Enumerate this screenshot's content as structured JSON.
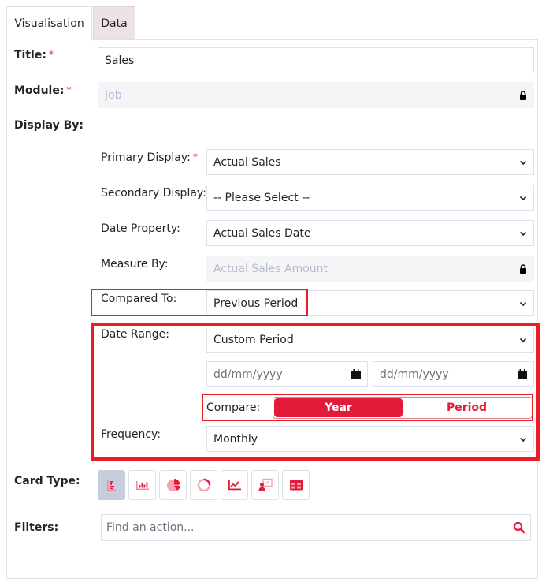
{
  "tabs": [
    {
      "label": "Visualisation",
      "active": true
    },
    {
      "label": "Data",
      "active": false
    }
  ],
  "form": {
    "title": {
      "label": "Title:",
      "required_mark": "*",
      "value": "Sales"
    },
    "module": {
      "label": "Module:",
      "required_mark": "*",
      "value": "Job",
      "locked": true
    },
    "display_by": {
      "label": "Display By:"
    },
    "primary_display": {
      "label": "Primary Display:",
      "required_mark": "*",
      "value": "Actual Sales"
    },
    "secondary_display": {
      "label": "Secondary Display:",
      "value": "-- Please Select --"
    },
    "date_property": {
      "label": "Date Property:",
      "value": "Actual Sales Date"
    },
    "measure_by": {
      "label": "Measure By:",
      "value": "Actual Sales Amount",
      "locked": true
    },
    "compared_to": {
      "label": "Compared To:",
      "value": "Previous Period"
    },
    "date_range": {
      "label": "Date Range:",
      "value": "Custom Period",
      "start_placeholder": "dd/mm/yyyy",
      "end_placeholder": "dd/mm/yyyy"
    },
    "compare": {
      "label": "Compare:",
      "options": [
        "Year",
        "Period"
      ],
      "selected": "Year"
    },
    "frequency": {
      "label": "Frequency:",
      "value": "Monthly"
    },
    "card_type": {
      "label": "Card Type:",
      "options": [
        {
          "icon": "horizontal-bar-chart-icon",
          "selected": true
        },
        {
          "icon": "vertical-bar-chart-icon",
          "selected": false
        },
        {
          "icon": "pie-chart-icon",
          "selected": false
        },
        {
          "icon": "donut-chart-icon",
          "selected": false
        },
        {
          "icon": "line-chart-icon",
          "selected": false
        },
        {
          "icon": "presenter-kpi-icon",
          "selected": false
        },
        {
          "icon": "table-icon",
          "selected": false
        }
      ]
    },
    "filters": {
      "label": "Filters:",
      "placeholder": "Find an action..."
    }
  },
  "colors": {
    "accent": "#e31b3b",
    "highlight_border": "#ee1c25",
    "selected_card_bg": "#c6cddf",
    "inactive_tab_bg": "#ede3e5",
    "readonly_bg": "#f5f5f8"
  }
}
